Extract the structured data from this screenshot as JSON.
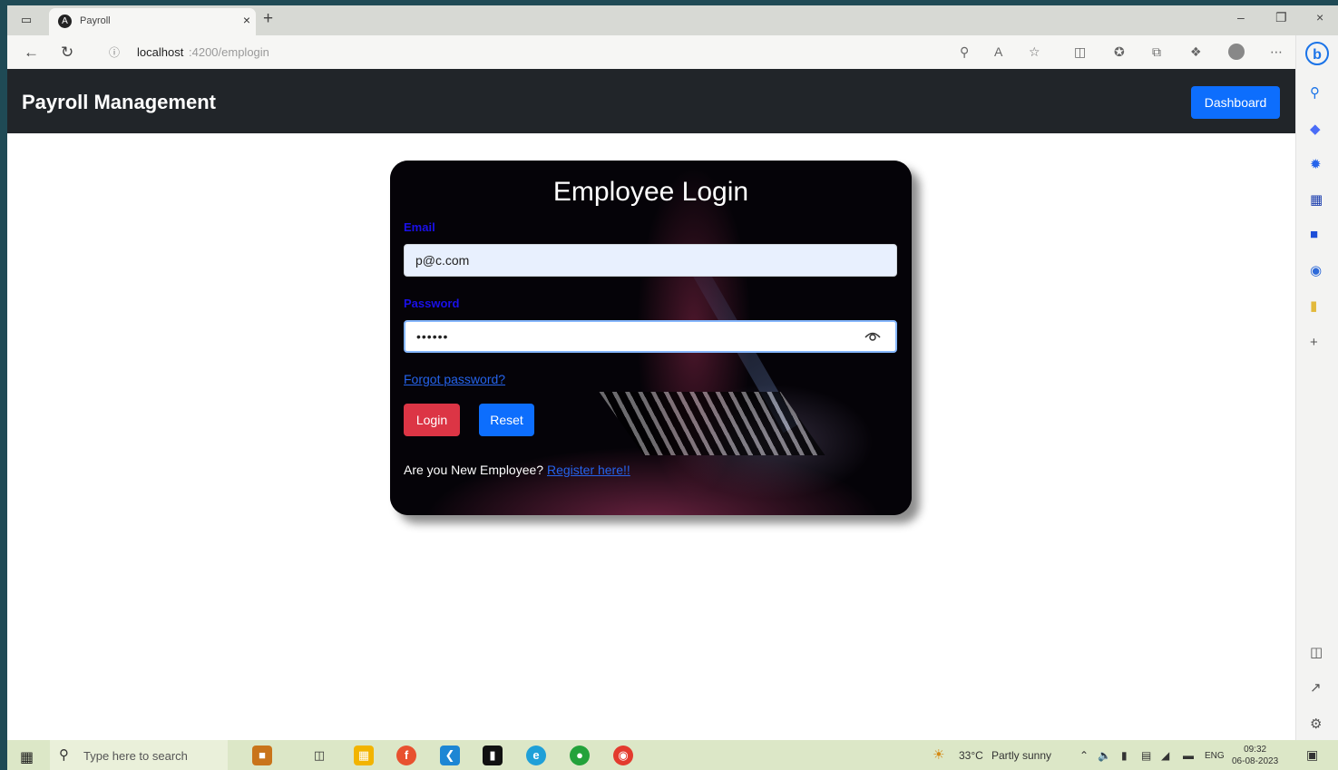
{
  "browser": {
    "tab_title": "Payroll",
    "url_host": "localhost",
    "url_path": ":4200/emplogin"
  },
  "app": {
    "brand": "Payroll Management",
    "dashboard_label": "Dashboard"
  },
  "login": {
    "title": "Employee Login",
    "email_label": "Email",
    "email_value": "p@c.com",
    "password_label": "Password",
    "password_value": "••••••",
    "forgot_label": "Forgot password?",
    "login_label": "Login",
    "reset_label": "Reset",
    "new_employee_text": "Are you New Employee? ",
    "register_label": "Register here!!"
  },
  "taskbar": {
    "search_placeholder": "Type here to search",
    "weather_temp": "33°C",
    "weather_text": "Partly sunny",
    "lang": "ENG",
    "time": "09:32",
    "date": "06-08-2023"
  },
  "colors": {
    "navbar_bg": "#212529",
    "primary": "#0d6efd",
    "danger": "#dc3545",
    "label_blue": "#1a10e8",
    "taskbar_bg": "#dce7c7"
  },
  "icons": {
    "tab_favicon": "angular-icon",
    "password_toggle": "eye-icon",
    "start": "windows-start-icon"
  }
}
